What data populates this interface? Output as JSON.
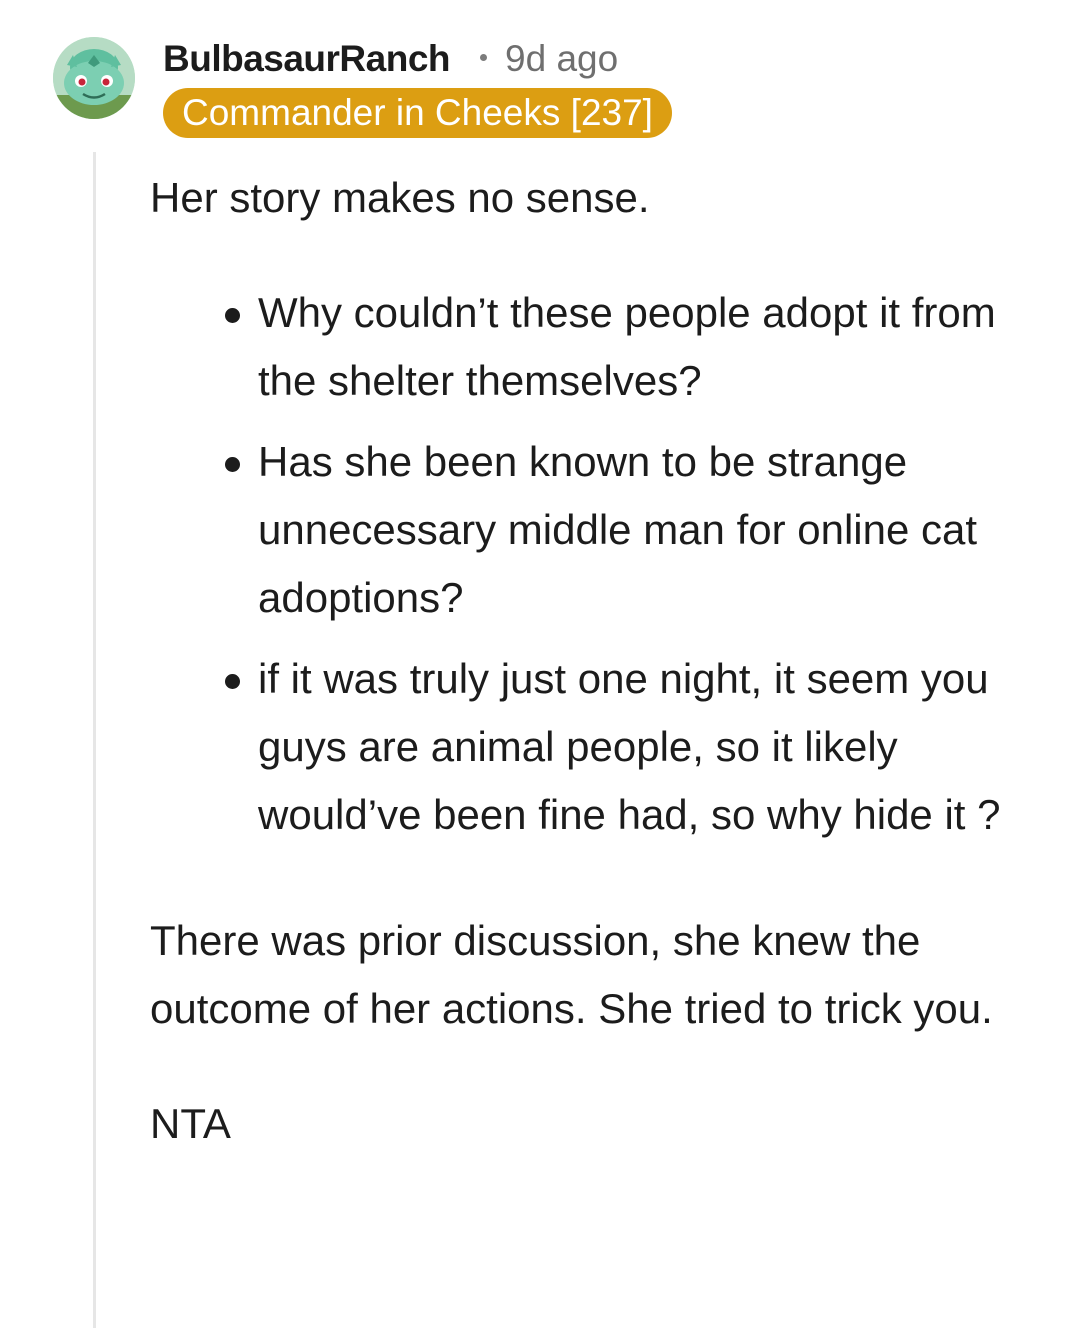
{
  "author": {
    "username": "BulbasaurRanch",
    "age": "9d ago",
    "flair": "Commander in Cheeks [237]",
    "avatar_icon": "bulbasaur-avatar-icon"
  },
  "comment": {
    "intro": "Her story makes no sense.",
    "points": [
      "Why couldn’t these people adopt it from the shelter themselves?",
      "Has she been known to be strange unnecessary middle man for online cat adoptions?",
      "if it was truly just one night, it seem you guys are animal people, so it likely would’ve been fine had, so why hide it ?"
    ],
    "closing": "There was prior discussion, she knew the outcome of her actions. She tried to trick you.",
    "verdict": "NTA"
  },
  "colors": {
    "flair_bg": "#dc9e12",
    "flair_text": "#ffffff",
    "text": "#1c1c1c",
    "meta": "#6f6f6f",
    "thread_line": "#e6e6e6"
  }
}
